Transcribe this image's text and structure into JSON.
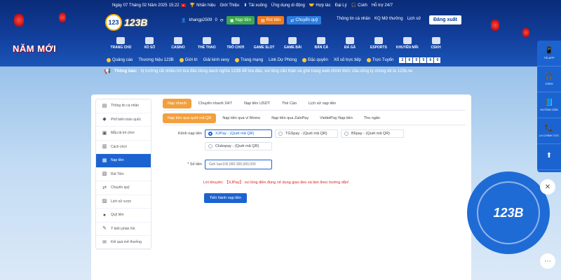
{
  "topbar": {
    "date": "Ngày 07 Tháng 02 Năm 2025",
    "time": "15:22",
    "items": [
      {
        "icon": "trophy-icon",
        "label": "Nhãn hiệu"
      },
      {
        "icon": "",
        "label": "Giới Thiệu"
      },
      {
        "icon": "download-icon",
        "label": "Tải xuống"
      },
      {
        "icon": "",
        "label": "Ứng dụng di động"
      },
      {
        "icon": "handshake-icon",
        "label": "Hợp tác"
      },
      {
        "icon": "",
        "label": "Đại Lý"
      },
      {
        "icon": "headset-icon",
        "label": "Cskh"
      },
      {
        "icon": "",
        "label": "Hỗ trợ 24/7"
      }
    ]
  },
  "logo": {
    "text": "123B",
    "badge": "123"
  },
  "user": {
    "username": "khangp2509",
    "balance": "0",
    "deposit_label": "Nạp tiền",
    "withdraw_label": "Rút tiền",
    "transfer_label": "Chuyển quỹ",
    "links": [
      "Thông tin cá nhân",
      "KQ Mở thưởng",
      "Lịch sử"
    ],
    "logout_label": "Đăng xuất"
  },
  "banner": {
    "newyear": "NĂM MỚI"
  },
  "nav": [
    {
      "label": "TRANG CHỦ",
      "icon": "home-icon"
    },
    {
      "label": "XỔ SỐ",
      "icon": "lottery-icon"
    },
    {
      "label": "CASINO",
      "icon": "casino-icon"
    },
    {
      "label": "THỂ THAO",
      "icon": "sports-icon"
    },
    {
      "label": "TRÒ CHƠI",
      "icon": "game-icon"
    },
    {
      "label": "GAME SLOT",
      "icon": "slot-icon"
    },
    {
      "label": "GAME BÀI",
      "icon": "cards-icon"
    },
    {
      "label": "BẮN CÁ",
      "icon": "fish-icon"
    },
    {
      "label": "ĐÁ GÀ",
      "icon": "rooster-icon"
    },
    {
      "label": "ESPORTS",
      "icon": "esports-icon"
    },
    {
      "label": "KHUYẾN MÃI",
      "icon": "gift-icon"
    },
    {
      "label": "CSKH",
      "icon": "support-icon"
    }
  ],
  "subnav": {
    "items": [
      "Quảng cáo",
      "Thương hiệu 123B",
      "Giới tri",
      "Giải kinh sexy",
      "Trang mạng",
      "Link Dự Phòng",
      "Đặc quyền",
      "Xổ số trực tiếp",
      "Trực Tuyến"
    ],
    "live_digits": [
      "2",
      "6",
      "5",
      "5",
      "6",
      "0"
    ]
  },
  "notice": {
    "label": "Thông báo:",
    "text": "hị trường rất nhiều trò lừa đảo dùng danh nghĩa 123B để lừa đảo, vui lòng cẩn thận và ghé trang web chính thức của công ty chúng tôi là 123b.ne"
  },
  "sidebar": {
    "items": [
      {
        "label": "Thông tin cá nhân",
        "icon": "id-card-icon",
        "active": false
      },
      {
        "label": "Phổ biến toàn quốc",
        "icon": "diamond-icon",
        "active": false
      },
      {
        "label": "Mẫu tả trò chơi",
        "icon": "controller-icon",
        "active": false
      },
      {
        "label": "Cách chơi",
        "icon": "book-icon",
        "active": false
      },
      {
        "label": "Nạp tiền",
        "icon": "wallet-icon",
        "active": true
      },
      {
        "label": "Rút Tiền",
        "icon": "withdraw-icon",
        "active": false
      },
      {
        "label": "Chuyển quỹ",
        "icon": "transfer-icon",
        "active": false
      },
      {
        "label": "Lịch sử cược",
        "icon": "history-icon",
        "active": false
      },
      {
        "label": "Quỹ tiền",
        "icon": "money-bag-icon",
        "active": false
      },
      {
        "label": "Ý kiến phản hồi",
        "icon": "feedback-icon",
        "active": false
      },
      {
        "label": "Kết quả mở thưởng",
        "icon": "result-icon",
        "active": false
      }
    ]
  },
  "tabs_primary": [
    "Nạp nhanh",
    "Chuyển nhanh 24/7",
    "Nạp tiền USDT",
    "Thẻ Cào",
    "Lịch sử nạp tiền"
  ],
  "tabs_secondary": [
    "Nạp tiền qua quét mã QR",
    "Nạp tiền qua ví Momo",
    "Nạp tiền qua ZaloPay",
    "ViettelPay Nạp tiền",
    "Thu ngân"
  ],
  "form": {
    "channel_label": "Kênh nạp tiền",
    "options": [
      {
        "label": "XJPay - (Quét mã QR)",
        "selected": true
      },
      {
        "label": "TGSpay - (Quét mã QR)",
        "selected": false
      },
      {
        "label": "B6pay - (Quét mã QR)",
        "selected": false
      },
      {
        "label": "Clubspay - (Quét mã QR)",
        "selected": false
      }
    ],
    "amount_label": "* Số tiền",
    "amount_placeholder": "Giới hạn100,000-300,000,000",
    "warning_prefix": "Lời khuyên:",
    "warning_text": "【XJPay】 vui lòng điền đúng nổ dung giao đeo và làm theo hướng dẫn!",
    "submit_label": "Tiến hành nạp tiền"
  },
  "side_rail": [
    {
      "label": "TẢI APP",
      "icon": "phone-icon"
    },
    {
      "label": "CSKH",
      "icon": "headset-icon"
    },
    {
      "label": "HƯỚNG DẪN",
      "icon": "guide-icon"
    },
    {
      "label": "LH CHÍNH TỨC",
      "icon": "call-icon"
    },
    {
      "label": "",
      "icon": "arrow-up-icon"
    }
  ],
  "badge": {
    "text": "123B"
  },
  "colors": {
    "primary": "#1b63d1",
    "accent": "#f2a03d",
    "header": "#0a2b78"
  }
}
